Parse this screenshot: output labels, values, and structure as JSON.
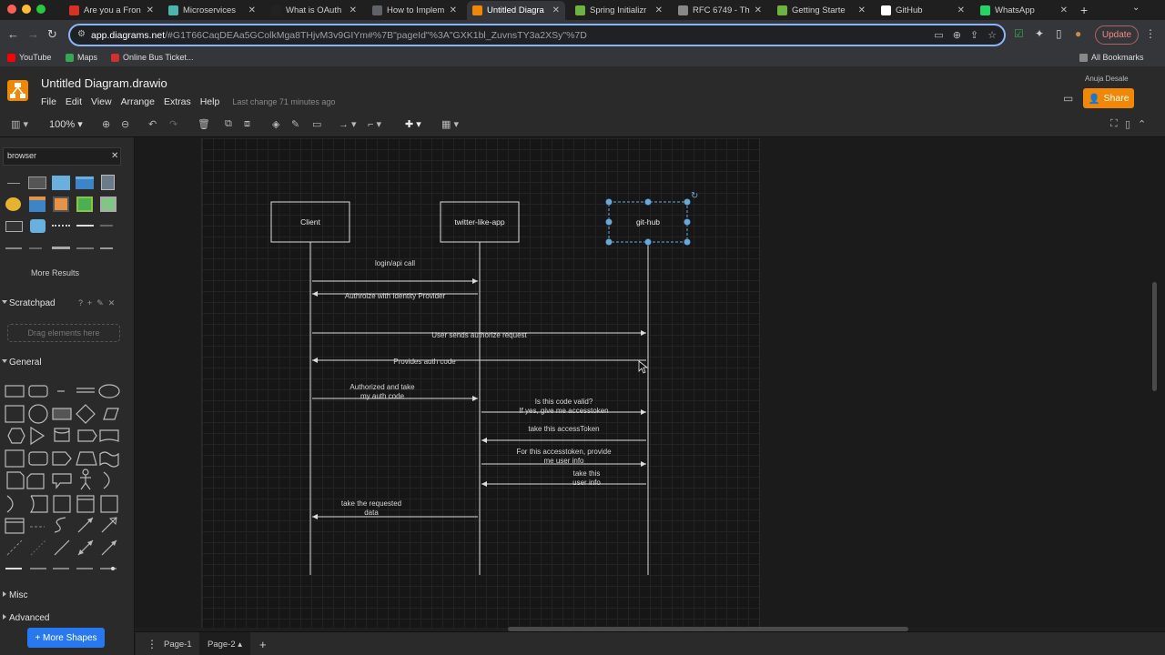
{
  "browser": {
    "tabs": [
      {
        "label": "Are you a Fron",
        "fav": "gmail-icon",
        "color": "#d93025"
      },
      {
        "label": "Microservices",
        "fav": "page-icon",
        "color": "#4db6ac"
      },
      {
        "label": "What is OAuth",
        "fav": "medium-icon",
        "color": "#222222"
      },
      {
        "label": "How to Implem",
        "fav": "globe-icon",
        "color": "#5f6368"
      },
      {
        "label": "Untitled Diagra",
        "fav": "drawio-icon",
        "color": "#f08705"
      },
      {
        "label": "Spring Initializr",
        "fav": "spring-icon",
        "color": "#6db33f"
      },
      {
        "label": "RFC 6749 - Th",
        "fav": "rfc-icon",
        "color": "#888888"
      },
      {
        "label": "Getting Starte",
        "fav": "spring-icon",
        "color": "#6db33f"
      },
      {
        "label": "GitHub",
        "fav": "github-icon",
        "color": "#ffffff"
      },
      {
        "label": "WhatsApp",
        "fav": "whatsapp-icon",
        "color": "#25d366"
      }
    ],
    "active_tab": 4,
    "url_host": "app.diagrams.net",
    "url_rest": "/#G1T66CaqDEAa5GColkMga8THjvM3v9GIYm#%7B\"pageId\"%3A\"GXK1bl_ZuvnsTY3a2XSy\"%7D",
    "update_label": "Update",
    "bookmarks": [
      {
        "label": "YouTube",
        "color": "#ff0000"
      },
      {
        "label": "Maps",
        "color": "#34a853"
      },
      {
        "label": "Online Bus Ticket...",
        "color": "#d32f2f"
      }
    ],
    "all_bookmarks_label": "All Bookmarks"
  },
  "app": {
    "title": "Untitled Diagram.drawio",
    "menus": [
      "File",
      "Edit",
      "View",
      "Arrange",
      "Extras",
      "Help"
    ],
    "last_change": "Last change 71 minutes ago",
    "user": "Anuja Desale",
    "share_label": "Share",
    "zoom": "100%"
  },
  "left_panel": {
    "search_value": "browser",
    "more_results": "More Results",
    "scratchpad": "Scratchpad",
    "drag_hint": "Drag elements here",
    "general": "General",
    "misc": "Misc",
    "advanced": "Advanced",
    "more_shapes": "+ More Shapes"
  },
  "diagram": {
    "actors": [
      "Client",
      "twitter-like-app",
      "git-hub"
    ],
    "messages": [
      {
        "line1": "login/api call",
        "line2": "",
        "from": 0,
        "to": 1
      },
      {
        "line1": "Authroize with Identity Provider",
        "line2": "",
        "from": 1,
        "to": 0
      },
      {
        "line1": "User sends authorize request",
        "line2": "",
        "from": 0,
        "to": 2
      },
      {
        "line1": "Provides auth code",
        "line2": "",
        "from": 2,
        "to": 0
      },
      {
        "line1": "Authorized and take",
        "line2": "my auth code",
        "from": 0,
        "to": 1
      },
      {
        "line1": "Is this code valid?",
        "line2": "If yes, give me accesstoken",
        "from": 1,
        "to": 2
      },
      {
        "line1": "take this accessToken",
        "line2": "",
        "from": 2,
        "to": 1
      },
      {
        "line1": "For this accesstoken, provide",
        "line2": "me user info",
        "from": 1,
        "to": 2
      },
      {
        "line1": "take this",
        "line2": "user info",
        "from": 2,
        "to": 1
      },
      {
        "line1": "take the requested",
        "line2": "data",
        "from": 1,
        "to": 0
      }
    ],
    "selected_actor": 2
  },
  "pages": {
    "tabs": [
      "Page-1",
      "Page-2"
    ],
    "active": 1
  }
}
